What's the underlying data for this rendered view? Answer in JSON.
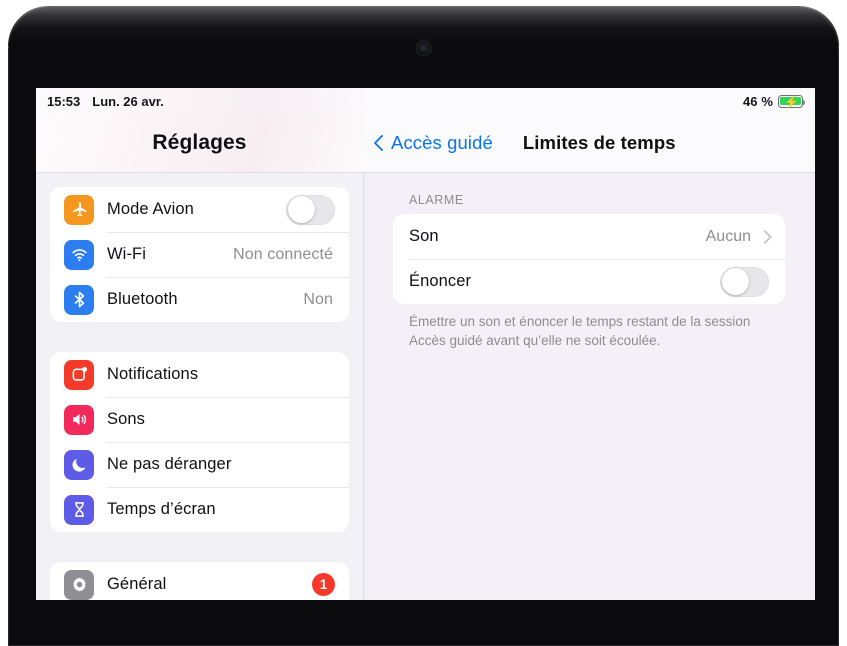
{
  "device": {
    "camera_label": "front-camera"
  },
  "status_bar": {
    "time": "15:53",
    "date": "Lun. 26 avr.",
    "battery_percent": "46 %",
    "battery_state": "charging"
  },
  "sidebar": {
    "title": "Réglages",
    "groups": [
      {
        "items": [
          {
            "label": "Mode Avion",
            "icon": "airplane-icon",
            "icon_color": "#f5971f",
            "accessory": "toggle",
            "toggle_on": false
          },
          {
            "label": "Wi-Fi",
            "icon": "wifi-icon",
            "icon_color": "#2c7ef0",
            "accessory": "value",
            "value": "Non connecté"
          },
          {
            "label": "Bluetooth",
            "icon": "bluetooth-icon",
            "icon_color": "#2c7ef0",
            "accessory": "value",
            "value": "Non"
          }
        ]
      },
      {
        "items": [
          {
            "label": "Notifications",
            "icon": "notifications-icon",
            "icon_color": "#f53a2a",
            "accessory": "none"
          },
          {
            "label": "Sons",
            "icon": "sound-icon",
            "icon_color": "#f2295b",
            "accessory": "none"
          },
          {
            "label": "Ne pas déranger",
            "icon": "moon-icon",
            "icon_color": "#5e5ce6",
            "accessory": "none"
          },
          {
            "label": "Temps d’écran",
            "icon": "hourglass-icon",
            "icon_color": "#5e5ce6",
            "accessory": "none"
          }
        ]
      },
      {
        "items": [
          {
            "label": "Général",
            "icon": "gear-icon",
            "icon_color": "#8e8e93",
            "accessory": "badge",
            "badge": "1"
          }
        ]
      }
    ]
  },
  "detail": {
    "back_label": "Accès guidé",
    "title": "Limites de temps",
    "section_header": "ALARME",
    "rows": [
      {
        "label": "Son",
        "accessory": "value-chevron",
        "value": "Aucun"
      },
      {
        "label": "Énoncer",
        "accessory": "toggle",
        "toggle_on": false
      }
    ],
    "footnote": "Émettre un son et énoncer le temps restant de la session Accès guidé avant qu’elle ne soit écoulée."
  },
  "colors": {
    "accent_blue": "#0a74f0",
    "badge_red": "#f6372a",
    "battery_green": "#32d657",
    "sidebar_bg": "#f2f1f6",
    "detail_bg": "#f3f1f7"
  }
}
